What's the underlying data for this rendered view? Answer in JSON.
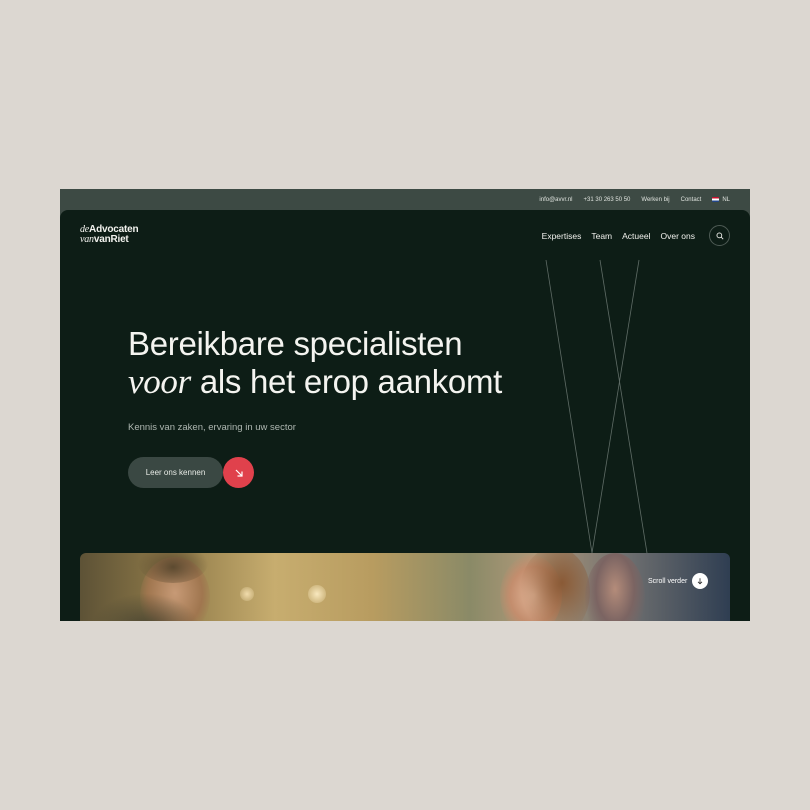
{
  "topbar": {
    "email": "info@avvr.nl",
    "phone": "+31 30 263 50 50",
    "jobs": "Werken bij",
    "contact": "Contact",
    "language": "NL"
  },
  "logo": {
    "prefix1": "de",
    "word1": "Advocaten",
    "prefix2": "van",
    "word2": "vanRiet"
  },
  "nav": {
    "items": [
      "Expertises",
      "Team",
      "Actueel",
      "Over ons"
    ],
    "search_icon": "search-icon"
  },
  "hero": {
    "title_line1": "Bereikbare specialisten",
    "title_italic": "voor",
    "title_line2_rest": " als het erop aankomt",
    "subtitle": "Kennis van zaken, ervaring in uw sector",
    "cta_label": "Leer ons kennen",
    "cta_icon": "arrow-down-right-icon"
  },
  "scroll": {
    "label": "Scroll verder",
    "icon": "arrow-down-icon"
  },
  "colors": {
    "background": "#dcd7d1",
    "page": "#0d1d16",
    "topbar": "#3d4a44",
    "accent": "#e0414c",
    "button": "#3a4843"
  }
}
